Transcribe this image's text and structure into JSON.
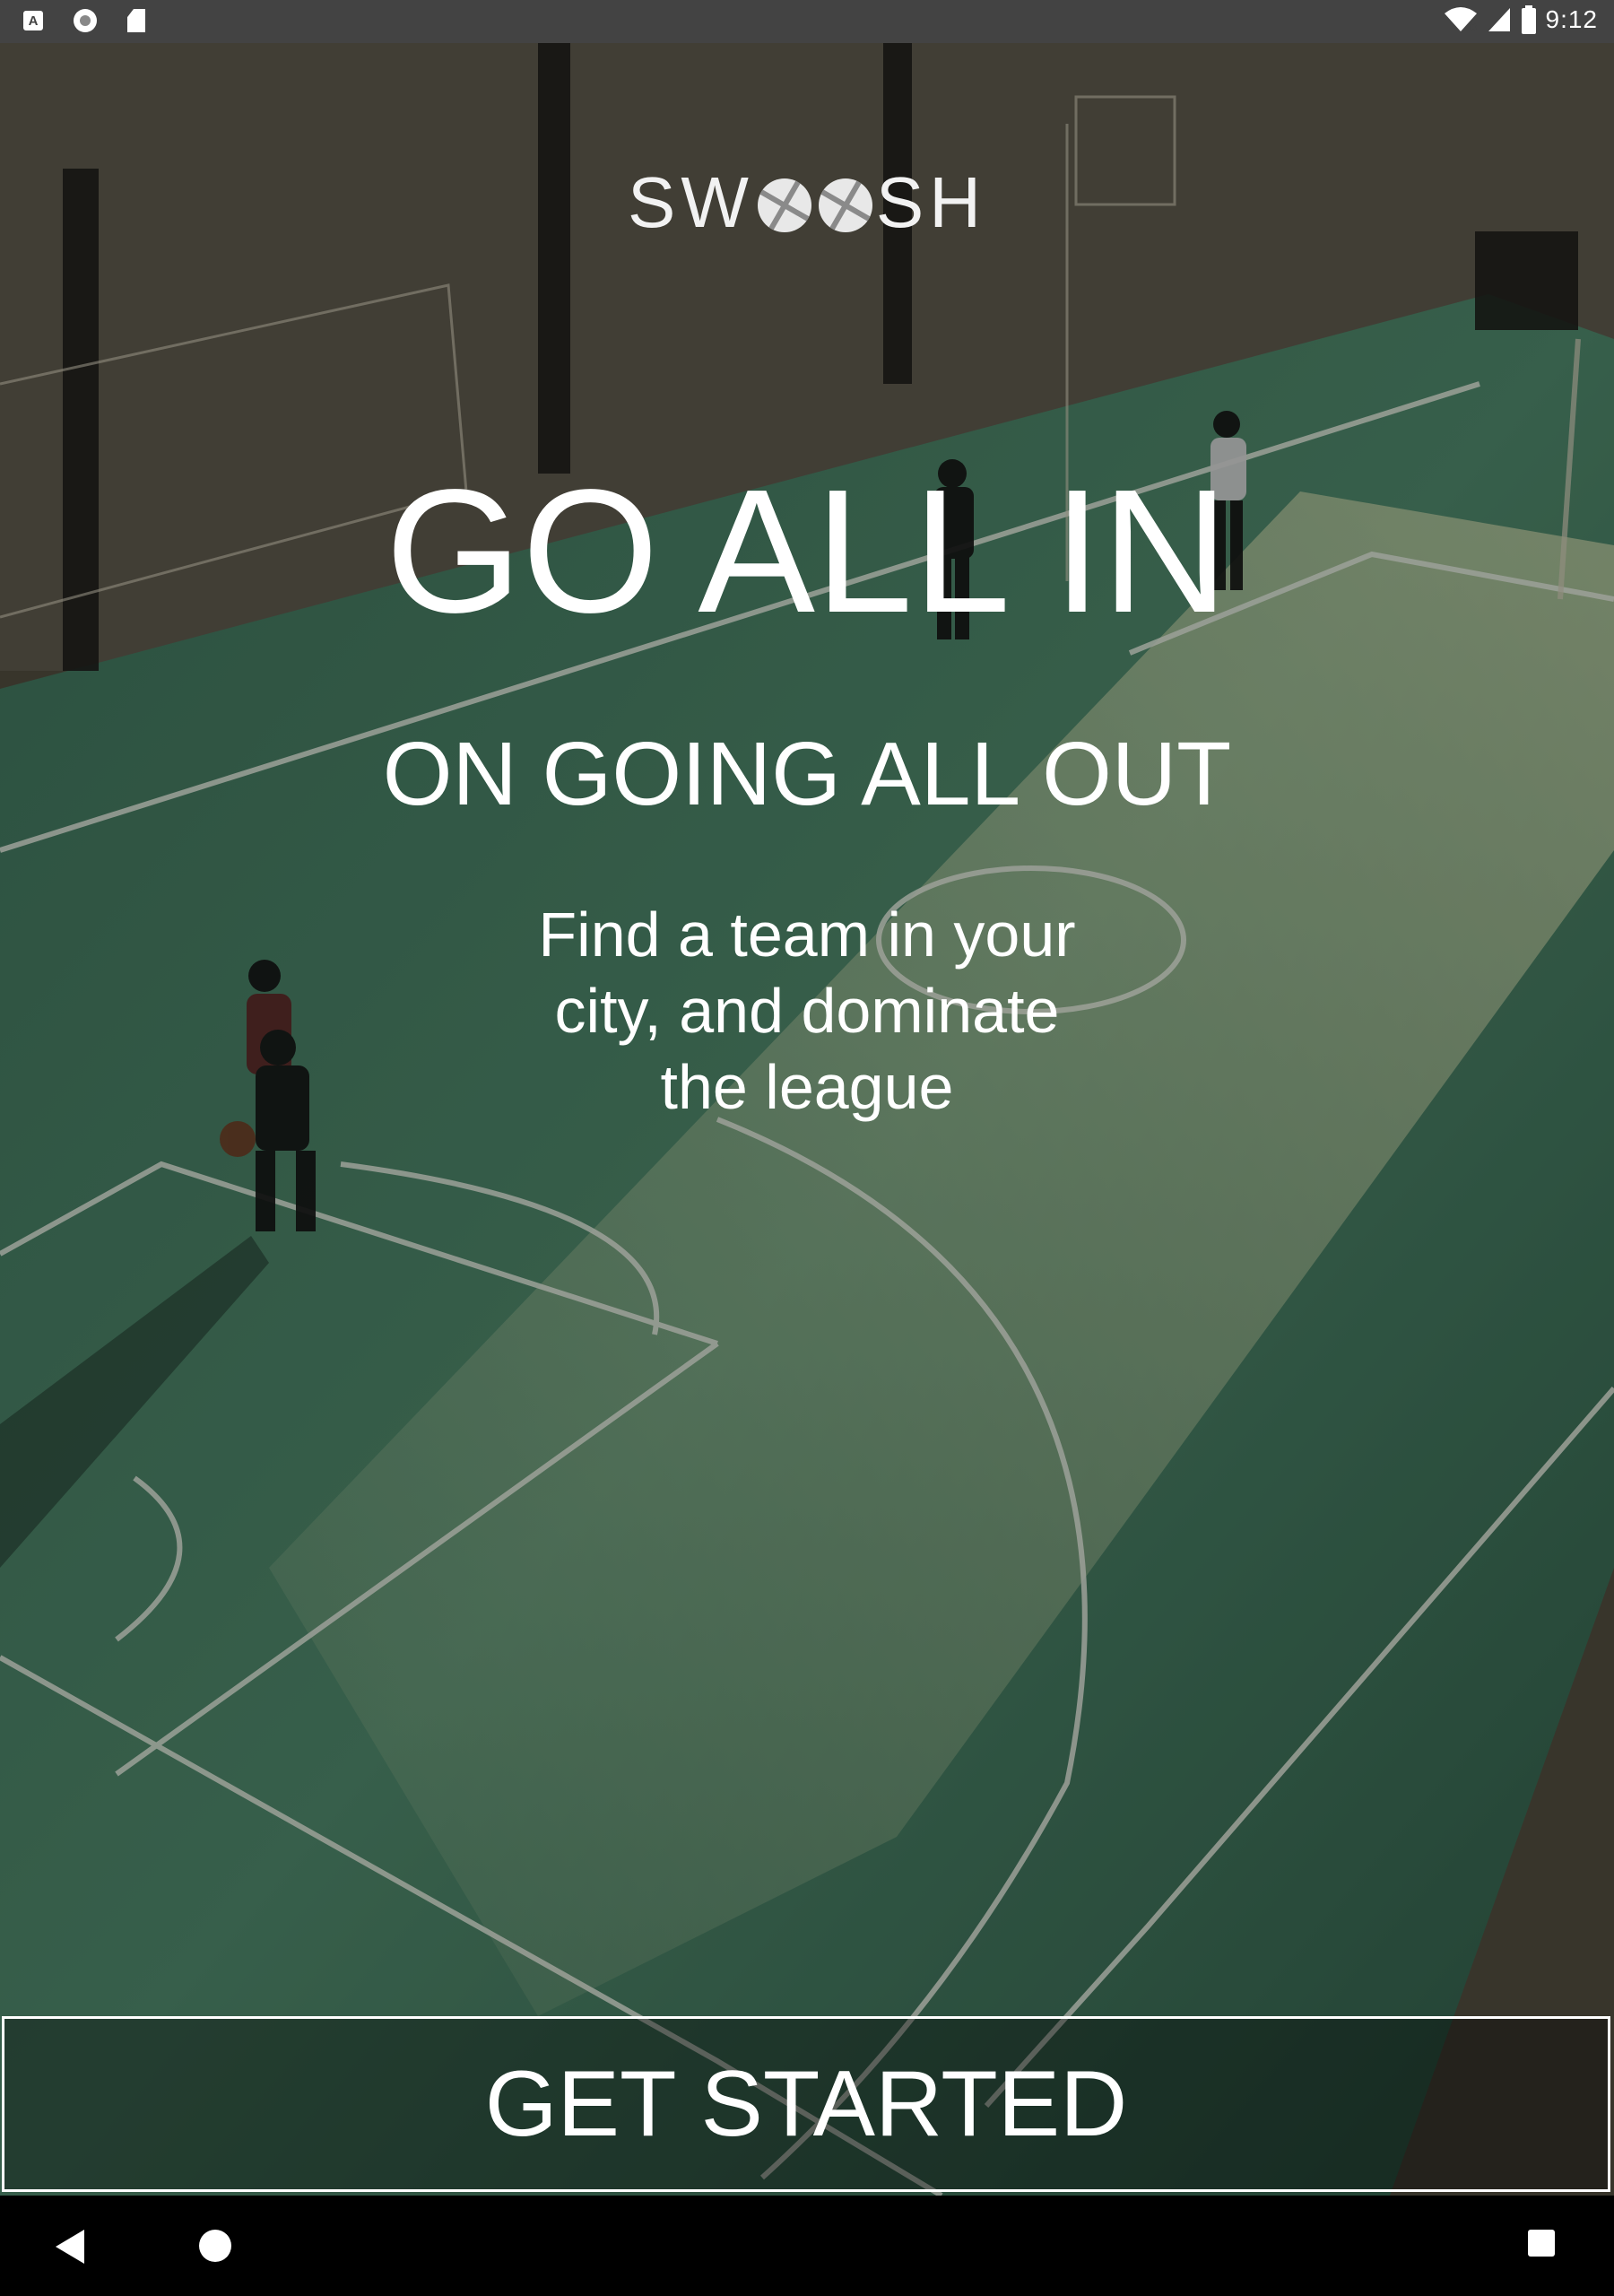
{
  "status_bar": {
    "time": "9:12",
    "left_icons": [
      "a-icon",
      "circle-icon",
      "sd-card-icon"
    ],
    "right_icons": [
      "wifi-icon",
      "signal-icon",
      "battery-icon"
    ]
  },
  "logo": {
    "prefix": "SW",
    "suffix": "SH"
  },
  "hero": {
    "headline": "GO ALL IN",
    "subheadline": "ON GOING ALL OUT",
    "tagline": "Find a team in your city, and dominate the league"
  },
  "cta": {
    "label": "GET STARTED"
  },
  "nav_bar": {
    "icons": [
      "back-icon",
      "home-icon",
      "recents-icon"
    ]
  },
  "colors": {
    "court_green": "#3f7a62",
    "court_dark": "#2c4a3c",
    "status_bar": "#434343",
    "nav_bar": "#000000",
    "text": "#ffffff"
  }
}
